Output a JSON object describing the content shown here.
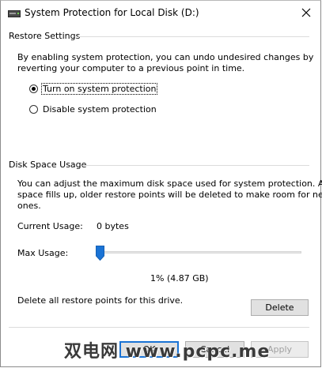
{
  "window": {
    "title": "System Protection for Local Disk (D:)",
    "title_icon": "drive-icon",
    "close_icon": "close-icon"
  },
  "restore_settings": {
    "section_label": "Restore Settings",
    "description_line1": "By enabling system protection, you can undo undesired changes by",
    "description_line2": "reverting your computer to a previous point in time.",
    "options": [
      {
        "label": "Turn on system protection",
        "selected": true
      },
      {
        "label": "Disable system protection",
        "selected": false
      }
    ]
  },
  "disk_space": {
    "section_label": "Disk Space Usage",
    "description_line1": "You can adjust the maximum disk space used for system protection. As",
    "description_line2": "space fills up, older restore points will be deleted to make room for new",
    "description_line3": "ones.",
    "current_usage_label": "Current Usage:",
    "current_usage_value": "0 bytes",
    "max_usage_label": "Max Usage:",
    "max_usage_value": "1% (4.87 GB)",
    "slider_percent": 1,
    "delete_text": "Delete all restore points for this drive.",
    "delete_button": "Delete"
  },
  "buttons": {
    "ok": "OK",
    "cancel": "Cancel",
    "apply": "Apply"
  },
  "watermark": "双电网 www.pcpc.me",
  "colors": {
    "focus_border": "#1a73d5",
    "slider_thumb": "#1a73d5"
  }
}
